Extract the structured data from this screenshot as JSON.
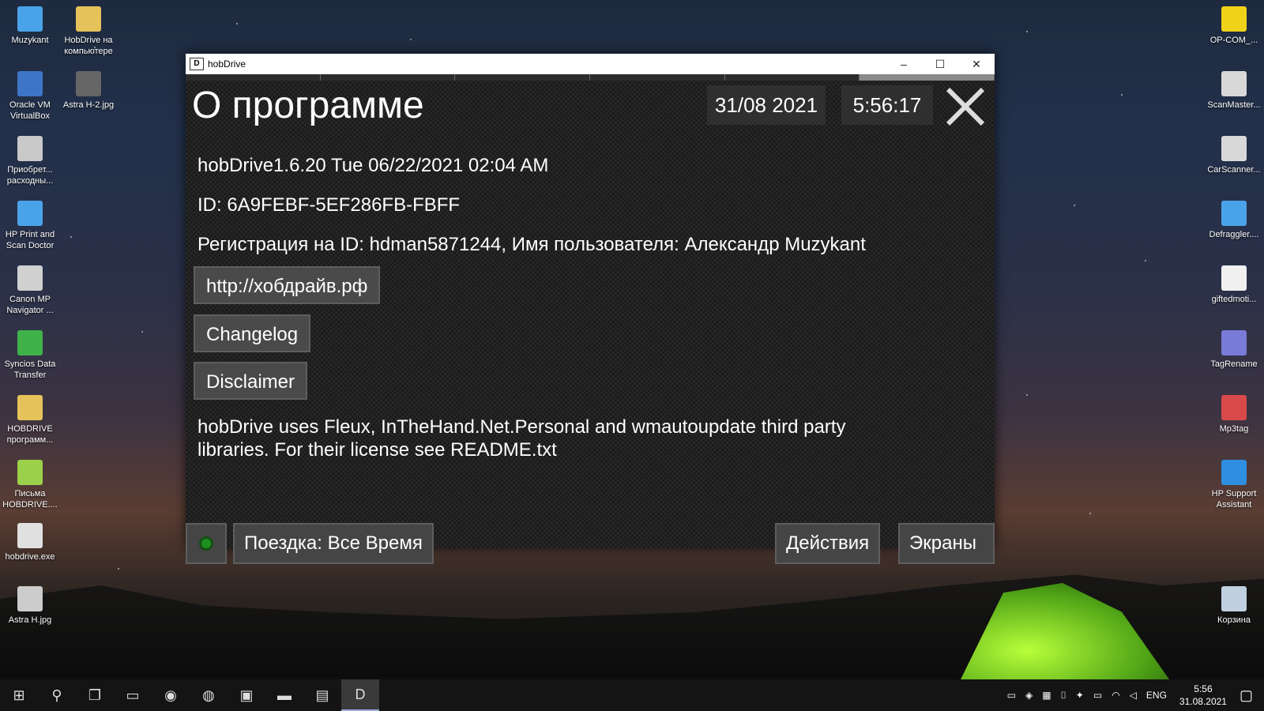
{
  "desktop": {
    "left_icons": [
      {
        "label": "Muzykant",
        "color": "#4aa3e8"
      },
      {
        "label": "HobDrive на компьютере",
        "color": "#e6c35a"
      },
      {
        "label": "Oracle VM VirtualBox",
        "color": "#3d76c8"
      },
      {
        "label": "Astra H-2.jpg",
        "color": "#666666"
      },
      {
        "label": "Приобрет... расходны...",
        "color": "#c9c9c9"
      },
      {
        "label": "HP Print and Scan Doctor",
        "color": "#4aa3e8"
      },
      {
        "label": "Canon MP Navigator ...",
        "color": "#d0d0d0"
      },
      {
        "label": "Syncios Data Transfer",
        "color": "#3fb24a"
      },
      {
        "label": "HOBDRIVE программ...",
        "color": "#e6c35a"
      },
      {
        "label": "Письма HOBDRIVE....",
        "color": "#9ad04a"
      },
      {
        "label": "hobdrive.exe",
        "color": "#e0e0e0"
      },
      {
        "label": "Astra H.jpg",
        "color": "#cccccc"
      }
    ],
    "right_icons": [
      {
        "label": "OP-COM_...",
        "color": "#f1d21a"
      },
      {
        "label": "ScanMaster...",
        "color": "#d8d8d8"
      },
      {
        "label": "CarScanner...",
        "color": "#d8d8d8"
      },
      {
        "label": "Defraggler....",
        "color": "#4aa3e8"
      },
      {
        "label": "giftedmoti...",
        "color": "#f0f0f0"
      },
      {
        "label": "TagRename",
        "color": "#7a7ad8"
      },
      {
        "label": "Mp3tag",
        "color": "#d84a4a"
      },
      {
        "label": "HP Support Assistant",
        "color": "#2e8ee0"
      },
      {
        "label": "Корзина",
        "color": "#c0d0e0"
      }
    ]
  },
  "window": {
    "title": "hobDrive",
    "icon_text": "D",
    "minimize": "–",
    "maximize": "☐",
    "close": "✕"
  },
  "app": {
    "heading": "О программе",
    "date": "31/08 2021",
    "time": "5:56:17",
    "version_line": "hobDrive1.6.20 Tue 06/22/2021  02:04 AM",
    "id_line": "ID: 6A9FEBF-5EF286FB-FBFF",
    "registration_line": "Регистрация на ID: hdman5871244, Имя пользователя: Александр Muzykant",
    "link_button": "http://хобдрайв.рф",
    "changelog_button": "Changelog",
    "disclaimer_button": "Disclaimer",
    "license_text": "hobDrive uses Fleux, InTheHand.Net.Personal and wmautoupdate third party libraries. For their license see README.txt",
    "trip_button": "Поездка: Все Время",
    "actions_button": "Действия",
    "screens_button": "Экраны"
  },
  "taskbar": {
    "start": "⊞",
    "search": "⚲",
    "taskview": "❐",
    "apps": [
      "▭",
      "◉",
      "◍",
      "▣",
      "▬",
      "▤",
      "D"
    ],
    "language": "ENG",
    "clock_time": "5:56",
    "clock_date": "31.08.2021",
    "notification": "▢"
  }
}
